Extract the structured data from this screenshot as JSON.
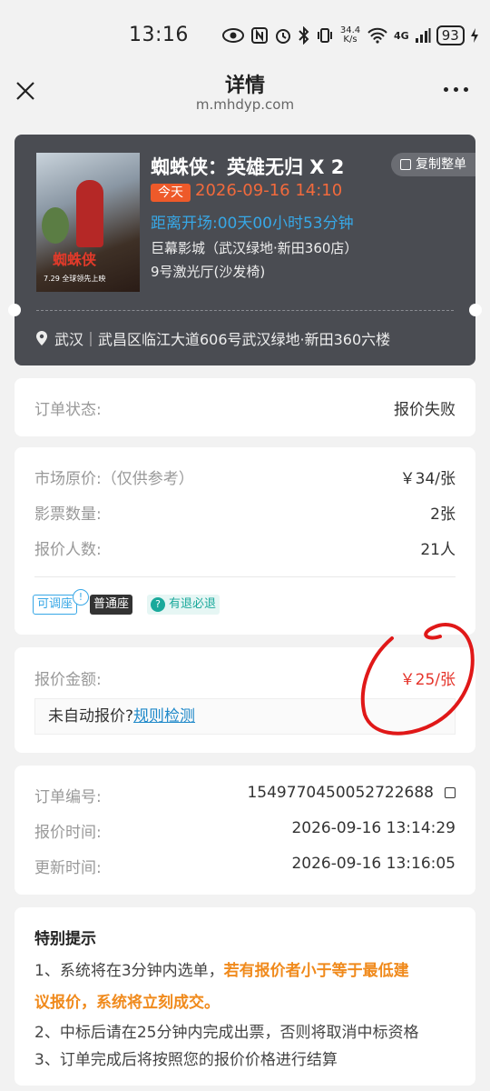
{
  "status_bar": {
    "time": "13:16",
    "net_speed_value": "34.4",
    "net_speed_unit": "K/s",
    "network": "4G",
    "battery": "93"
  },
  "header": {
    "title": "详情",
    "url": "m.mhdyp.com"
  },
  "movie": {
    "title": "蜘蛛侠：英雄无归  X 2",
    "copy_label": "复制整单",
    "today_badge": "今天",
    "showtime": "2026-09-16 14:10",
    "countdown": "距离开场:00天00小时53分钟",
    "cinema": "巨幕影城（武汉绿地·新田360店）",
    "hall": "9号激光厅(沙发椅)",
    "address": "武汉｜武昌区临江大道606号武汉绿地·新田360六楼",
    "poster_title": "蜘蛛侠",
    "poster_date": "7.29 全球领先上映"
  },
  "order_status": {
    "label": "订单状态:",
    "value": "报价失败"
  },
  "price_info": {
    "market_label": "市场原价:",
    "market_note": "（仅供参考）",
    "market_value": "￥34/张",
    "qty_label": "影票数量:",
    "qty_value": "2张",
    "bidders_label": "报价人数:",
    "bidders_value": "21人",
    "tags": {
      "adjustable": "可调座",
      "info": "!",
      "normal": "普通座",
      "refund": "有退必退"
    }
  },
  "quote": {
    "label": "报价金额:",
    "value": "￥25/张",
    "auto_prompt": "未自动报价?",
    "rule_link": "规则检测"
  },
  "order_meta": {
    "id_label": "订单编号:",
    "id_value": "1549770450052722688",
    "quote_time_label": "报价时间:",
    "quote_time_value": "2026-09-16 13:14:29",
    "update_time_label": "更新时间:",
    "update_time_value": "2026-09-16 13:16:05"
  },
  "tips": {
    "title": "特别提示",
    "line1_prefix": "1、系统将在3分钟内选单，",
    "line1_highlight_a": "若有报价者小于等于最低建",
    "line1_highlight_b": "议报价，系统将立刻成交。",
    "line2": "2、中标后请在25分钟内完成出票，否则将取消中标资格",
    "line3": "3、订单完成后将按照您的报价价格进行结算"
  },
  "colors": {
    "accent_orange": "#f26a3c",
    "link_blue": "#1e88c9",
    "countdown_blue": "#37a7e6",
    "price_red": "#e5332a",
    "annotation_red": "#e01818"
  }
}
